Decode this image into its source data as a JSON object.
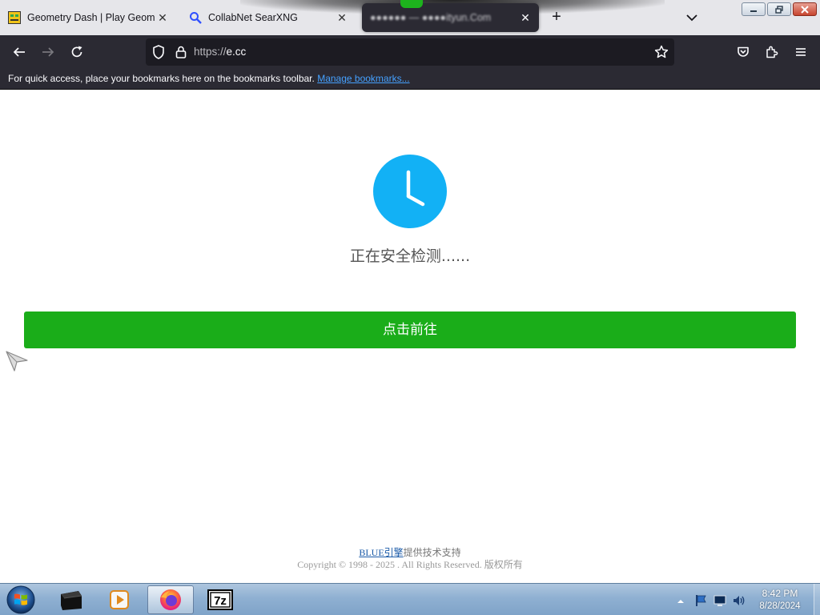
{
  "browser": {
    "tabs": [
      {
        "label": "Geometry Dash | Play Geometry Dash Online",
        "close": "✕"
      },
      {
        "label": "CollabNet SearXNG",
        "close": "✕"
      },
      {
        "label": "●●●●●● — ●●●●ityun.Com",
        "close": "✕"
      }
    ],
    "new_tab": "+",
    "url": {
      "scheme": "https://",
      "host": "e.cc"
    },
    "bookmarks_bar": {
      "message": "For quick access, place your bookmarks here on the bookmarks toolbar.",
      "link": "Manage bookmarks..."
    }
  },
  "page": {
    "status_text": "正在安全检测......",
    "go_button": "点击前往",
    "footer": {
      "brand_link": "BLUE引擎",
      "brand_suffix": "提供技术支持",
      "copyright": "Copyright © 1998 - 2025 . All Rights Reserved. 版权所有"
    },
    "accent_color": "#1aad19",
    "clock_color": "#12b1f5"
  },
  "taskbar": {
    "time": "8:42 PM",
    "date": "8/28/2024"
  }
}
